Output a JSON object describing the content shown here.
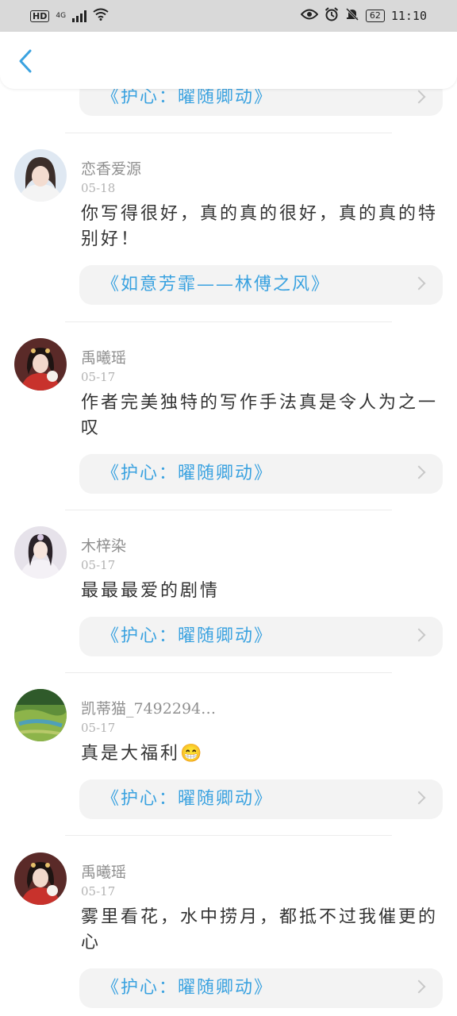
{
  "status_bar": {
    "hd": "HD",
    "network": "4G",
    "battery": "62",
    "time": "11:10"
  },
  "header": {
    "back_icon": "chevron-left-icon"
  },
  "top_link": {
    "label": "《护心：曜随卿动》"
  },
  "comments": [
    {
      "username": "恋香爱源",
      "date": "05-18",
      "text": "你写得很好，真的真的很好，真的真的特别好！",
      "link": "《如意芳霏——林傅之风》"
    },
    {
      "username": "禹曦瑶",
      "date": "05-17",
      "text": "作者完美独特的写作手法真是令人为之一叹",
      "link": "《护心：曜随卿动》"
    },
    {
      "username": "木梓染",
      "date": "05-17",
      "text": "最最最爱的剧情",
      "link": "《护心：曜随卿动》"
    },
    {
      "username": "凯蒂猫_7492294…",
      "date": "05-17",
      "text": "真是大福利😁",
      "link": "《护心：曜随卿动》"
    },
    {
      "username": "禹曦瑶",
      "date": "05-17",
      "text": "雾里看花，水中捞月，都抵不过我催更的心",
      "link": "《护心：曜随卿动》"
    }
  ],
  "colors": {
    "link": "#3aa2e0",
    "username": "#8f8f8f",
    "date": "#b3b3b3",
    "card": "#f3f3f3",
    "status_bar": "#d9d9d9"
  }
}
